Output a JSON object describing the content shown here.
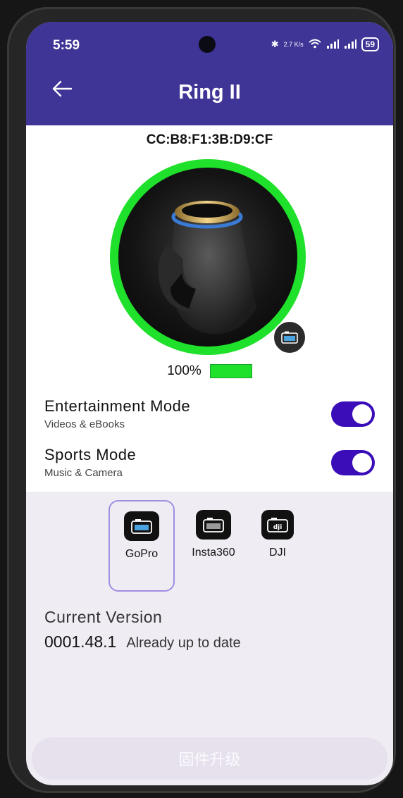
{
  "status_bar": {
    "time": "5:59",
    "network_speed": "2.7 K/s",
    "battery": "59"
  },
  "appbar": {
    "title": "Ring II"
  },
  "device": {
    "mac": "CC:B8:F1:3B:D9:CF",
    "battery_percent": "100%",
    "battery_level": 1.0
  },
  "modes": [
    {
      "title": "Entertainment Mode",
      "subtitle": "Videos & eBooks",
      "enabled": true
    },
    {
      "title": "Sports Mode",
      "subtitle": "Music & Camera",
      "enabled": true
    }
  ],
  "cameras": [
    {
      "label": "GoPro",
      "selected": true
    },
    {
      "label": "Insta360",
      "selected": false
    },
    {
      "label": "DJI",
      "selected": false
    }
  ],
  "firmware": {
    "title": "Current Version",
    "version": "0001.48.1",
    "status": "Already up to date",
    "upgrade_label": "固件升级"
  },
  "colors": {
    "accent": "#3e3596",
    "toggle": "#3a0db8",
    "battery": "#1fe02a"
  }
}
